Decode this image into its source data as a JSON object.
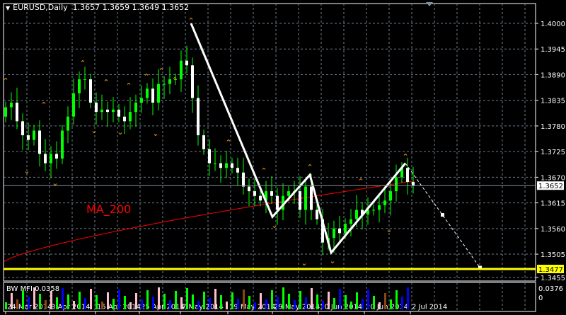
{
  "header": {
    "symbol": "EURUSD,Daily",
    "ohlc": "1.3657 1.3659 1.3649 1.3652"
  },
  "indicator_label": "MA_200",
  "subwindow": {
    "label": "BW MFI 0.0358",
    "scale_max": "0.0376",
    "scale_min": "0"
  },
  "price_axis": [
    "1.4000",
    "1.3945",
    "1.3890",
    "1.3835",
    "1.3780",
    "1.3725",
    "1.3670",
    "1.3615",
    "1.3560",
    "1.3505",
    "1.3455"
  ],
  "current_price": "1.3652",
  "hline_price": "1.3477",
  "date_axis": [
    "24 Mar 2014",
    "3 Apr 2014",
    "15 Apr 2014",
    "25 Apr 2014",
    "7 May 2014",
    "19 May 2014",
    "29 May 2014",
    "10 Jun 2014",
    "20 Jun 2014",
    "2 Jul 2014"
  ],
  "colors": {
    "bull": "#00ff00",
    "bear": "#ffffff",
    "ma": "#ff0000",
    "hline": "#ffff00",
    "fractal": "#ffa500",
    "zigzag": "#ffffff"
  },
  "chart_data": {
    "type": "candlestick",
    "closes": [
      1.382,
      1.383,
      1.379,
      1.376,
      1.375,
      1.377,
      1.372,
      1.37,
      1.372,
      1.371,
      1.377,
      1.38,
      1.385,
      1.388,
      1.388,
      1.383,
      1.381,
      1.3815,
      1.381,
      1.3815,
      1.38,
      1.379,
      1.381,
      1.383,
      1.384,
      1.386,
      1.383,
      1.387,
      1.387,
      1.388,
      1.388,
      1.392,
      1.391,
      1.384,
      1.376,
      1.373,
      1.37,
      1.37,
      1.369,
      1.37,
      1.369,
      1.368,
      1.365,
      1.364,
      1.363,
      1.362,
      1.364,
      1.363,
      1.36,
      1.363,
      1.364,
      1.364,
      1.36,
      1.365,
      1.36,
      1.358,
      1.353,
      1.354,
      1.356,
      1.355,
      1.357,
      1.358,
      1.36,
      1.359,
      1.36,
      1.36,
      1.361,
      1.362,
      1.364,
      1.367,
      1.369,
      1.366,
      1.3652
    ],
    "zigzag": [
      1.4,
      1.3585,
      1.3675,
      1.351,
      1.37,
      1.359,
      1.3477
    ],
    "ylim": [
      1.344,
      1.4045
    ],
    "mfi_colors": "gpbgbpgbpgbgpgbpgbpgbgppbgbpgbgpggbgbpgpgbbgbpbgbggbgbpgbpgbgggbbgpbggbb"
  }
}
